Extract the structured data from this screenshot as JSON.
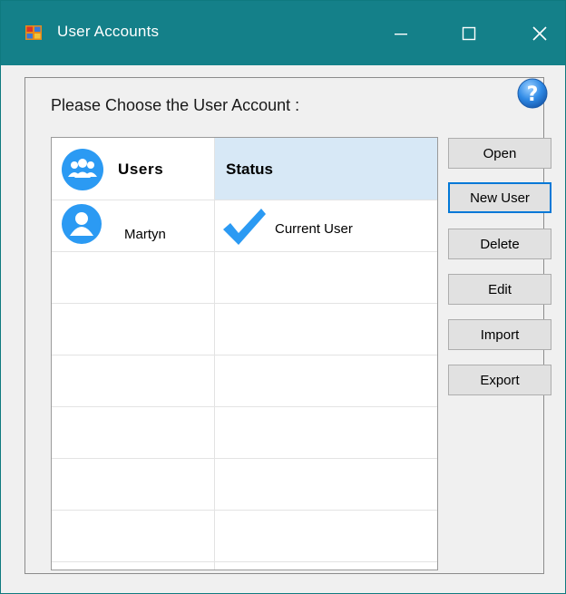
{
  "window": {
    "title": "User Accounts",
    "icons": {
      "app": "app-icon",
      "minimize": "minimize-icon",
      "maximize": "maximize-icon",
      "close": "close-icon"
    }
  },
  "main": {
    "prompt": "Please Choose the User Account :",
    "help_icon": "help-icon"
  },
  "list": {
    "columns": [
      {
        "label": "Users",
        "icon": "users-group-icon"
      },
      {
        "label": "Status"
      }
    ],
    "rows": [
      {
        "name": "Martyn",
        "status": "Current User",
        "icon": "user-avatar-icon",
        "status_icon": "checkmark-icon"
      }
    ]
  },
  "buttons": {
    "open": "Open",
    "new_user": "New User",
    "delete": "Delete",
    "edit": "Edit",
    "import": "Import",
    "export": "Export"
  },
  "colors": {
    "titlebar": "#148089",
    "accent": "#0078d7",
    "list_header_highlight": "#d7e8f6",
    "icon_blue": "#2b9af3"
  }
}
